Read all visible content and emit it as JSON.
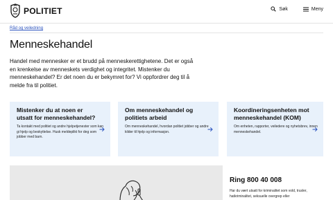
{
  "header": {
    "logo_text": "POLITIET",
    "search_label": "Søk",
    "menu_label": "Meny"
  },
  "breadcrumb": {
    "label": "Råd og veiledning"
  },
  "page": {
    "title": "Menneskehandel",
    "intro": "Handel med mennesker er et brudd på menneskerettighetene. Det er også en krenkelse av menneskets verdighet og integritet. Mistenker du menneskehandel? Er det noen du er bekymret for? Vi oppfordrer deg til å melde fra til politiet."
  },
  "cards": [
    {
      "title": "Mistenker du at noen er utsatt for menneskehandel?",
      "body": "Ta kontakt med politiet og andre hjelpetjenester som kan gi hjelp og beskyttelse. Husk meldeplikt for deg som jobber med barn."
    },
    {
      "title": "Om menneskehandel og politiets arbeid",
      "body": "Om menneskehandel, hvordan politiet jobber og andre kilder til hjelp og informasjon."
    },
    {
      "title": "Koordineringsenheten mot menneskehandel (KOM)",
      "body": "Om enheten, rapporter, veiledere og nyhetsbrev, innen menneskehandel."
    }
  ],
  "ring": {
    "title": "Ring 800 40 008",
    "text": "Har du vært utsatt for kriminalitet som vold, trusler, hatkriminalitet, seksuelle overgrep eller"
  },
  "colors": {
    "card_bg": "#e8f1fb",
    "link": "#2a52be",
    "panel_bg": "#e9e9e9"
  }
}
